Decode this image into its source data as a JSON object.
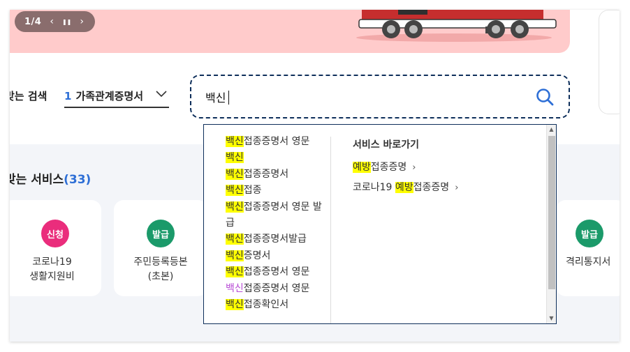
{
  "banner": {
    "pager_count": "1/4",
    "prev_glyph": "‹",
    "pause_glyph": "❚❚",
    "next_glyph": "›",
    "bg_color": "#ffcbcb"
  },
  "search": {
    "title": "맞는 검색",
    "category_number": "1",
    "category_label": "가족관계증명서",
    "query": "백신",
    "border_color": "#0d2e5a",
    "icon": "search-icon",
    "accent_color": "#2e6fd6"
  },
  "services": {
    "title": "맞는 서비스",
    "count": "(33)",
    "cards": [
      {
        "badge": "신청",
        "line1": "코로나19",
        "line2": "생활지원비"
      },
      {
        "badge": "발급",
        "line1": "주민등록등본",
        "line2": "(초본)"
      },
      {
        "badge": "발급",
        "line1": "격리통지서",
        "line2": ""
      }
    ],
    "badge_colors": {
      "apply": "#ea2d7c",
      "issue": "#1b9a6a"
    }
  },
  "autocomplete": {
    "suggestions": [
      {
        "hl": "백신",
        "rest": "접종증명서 영문"
      },
      {
        "hl": "백신",
        "rest": ""
      },
      {
        "hl": "백신",
        "rest": "접종증명서"
      },
      {
        "hl": "백신",
        "rest": "접종"
      },
      {
        "hl": "백신",
        "rest": "접종증명서 영문 발급"
      },
      {
        "hl": "백신",
        "rest": "접종증명서발급"
      },
      {
        "hl": "백신",
        "rest": "증명서"
      },
      {
        "hl": "백신",
        "rest": "접종증명서 영문"
      },
      {
        "hl": "백신",
        "rest": "접종증명서 영문"
      },
      {
        "hl": "백신",
        "rest": "접종확인서"
      }
    ],
    "shortcut_title": "서비스 바로가기",
    "shortcuts": [
      {
        "pre": "",
        "hl": "예방",
        "post": "접종증명"
      },
      {
        "pre": "코로나19 ",
        "hl": "예방",
        "post": "접종증명"
      }
    ],
    "arrow_glyph": "›",
    "highlight_color": "#ffff00",
    "visited_color": "#b84dd6"
  }
}
